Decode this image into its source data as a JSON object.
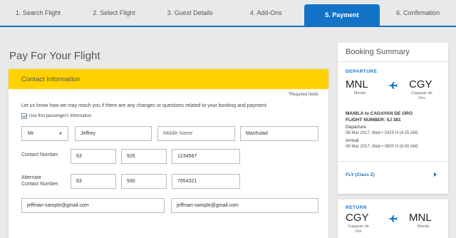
{
  "steps": [
    {
      "label": "1. Search Flight"
    },
    {
      "label": "2. Select Flight"
    },
    {
      "label": "3. Guest Details"
    },
    {
      "label": "4. Add-Ons"
    },
    {
      "label": "5. Payment"
    },
    {
      "label": "6. Confirmation"
    }
  ],
  "active_step": "5. Payment",
  "page": {
    "title": "Pay For Your Flight"
  },
  "contact": {
    "header": "Contact Information",
    "required_note": "*Required fields",
    "info_text": "Let us know how we may reach you if there are any changes or questions related to your booking and payment.",
    "use_passenger_info": "Use first passenger's information",
    "title_value": "Mr.",
    "first_name": "Jeffrey",
    "middle_name_placeholder": "Middle Name",
    "last_name": "Manhulad",
    "contact_number_label": "Contact Number:",
    "contact_number": {
      "country": "63",
      "area": "926",
      "number": "1234567"
    },
    "alternate_label_1": "Alternate",
    "alternate_label_2": "Contact Number:",
    "alternate_number": {
      "country": "63",
      "area": "930",
      "number": "7654321"
    },
    "email": "jeffman-sample@gmail.com",
    "email_confirm": "jeffman-sample@gmail.com"
  },
  "summary": {
    "title": "Booking Summary",
    "departure": {
      "label": "DEPARTURE",
      "from_code": "MNL",
      "from_city": "Manila",
      "to_code": "CGY",
      "to_city_1": "Cagayan de",
      "to_city_2": "Oro",
      "route": "MANILA to CAGAYAN DE ORO",
      "flight": "FLIGHT NUMBER: 5J 381",
      "dep_label": "Departure",
      "dep_time": "08 Mar 2017, Wed • 0425 H (4:25 AM)",
      "arr_label": "Arrival",
      "arr_time": "08 Mar 2017, Wed • 0600 H (6:00 AM)",
      "fare": "FLY (Class Z)"
    },
    "return": {
      "label": "RETURN",
      "from_code": "CGY",
      "from_city_1": "Cagayan de",
      "from_city_2": "Oro",
      "to_code": "MNL",
      "to_city": "Manila"
    }
  },
  "colors": {
    "brand_blue": "#1273c7",
    "brand_yellow": "#ffd200"
  }
}
